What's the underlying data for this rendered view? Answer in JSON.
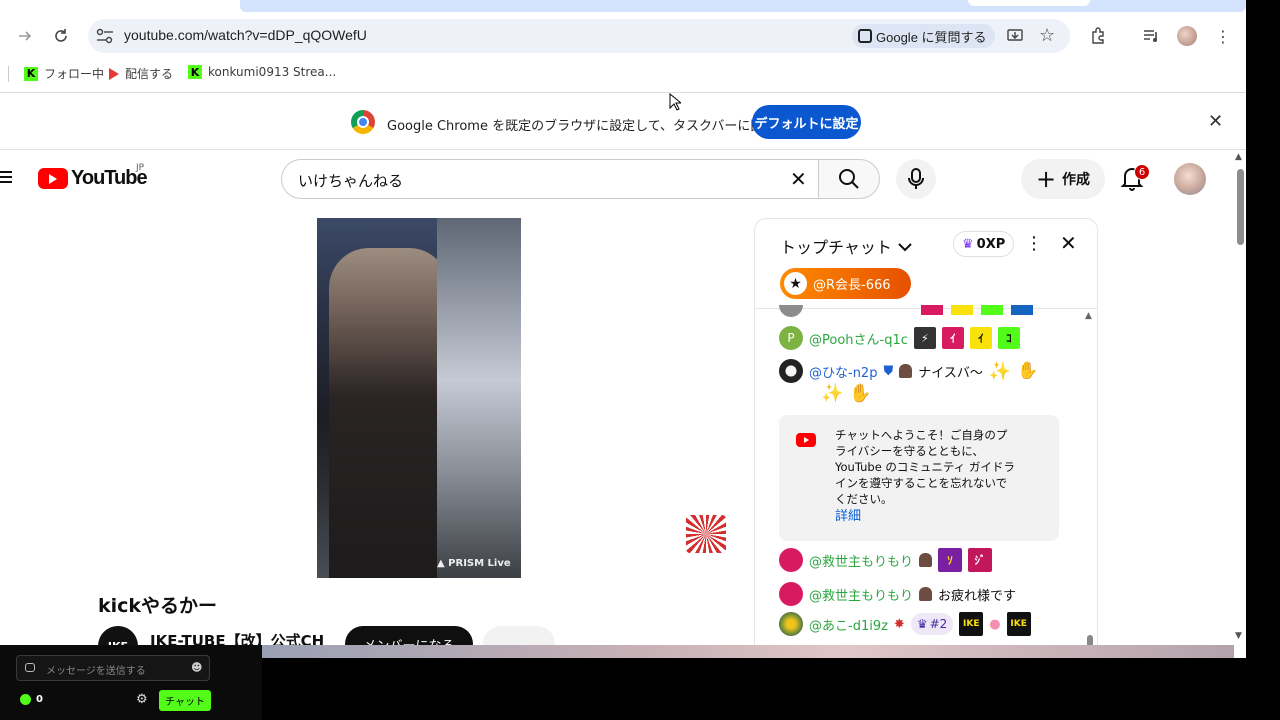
{
  "browser": {
    "url": "youtube.com/watch?v=dDP_qQOWefU",
    "ask_google_label": "Google に質問する",
    "bookmarks": [
      {
        "label": "フォロー中",
        "icon": "kick-logo-icon"
      },
      {
        "label": "配信する",
        "icon": "youtube-red-icon"
      },
      {
        "label": "konkumi0913 Strea...",
        "icon": "kick-logo-icon"
      }
    ]
  },
  "banner": {
    "text": "Google Chrome を既定のブラウザに設定して、タスクバーに固定する",
    "button_label": "デフォルトに設定"
  },
  "youtube": {
    "logo_text": "YouTube",
    "region": "JP",
    "search_value": "いけちゃんねる",
    "create_label": "作成",
    "notification_count": "6",
    "video_watermark": "PRISM Live",
    "video_title": "kickやるかー",
    "channel_name": "IKE-TUBE【改】公式CH",
    "channel_logo_text": "IKE",
    "member_button_label": "メンバーになる"
  },
  "chat": {
    "mode_label": "トップチャット",
    "xp_label": "0XP",
    "pinned_user": "@R会長-666",
    "messages": [
      {
        "author": "@Poohさん-q1c",
        "text": "",
        "avatar_letter": "P",
        "avatar_color": "#7cb342"
      },
      {
        "author": "@ひな-n2p",
        "text": "ナイスバ〜",
        "avatar_letter": "",
        "avatar_color": "#222222"
      },
      {
        "author": "@救世主もりもり",
        "text": "",
        "avatar_letter": "",
        "avatar_color": "#d81b60"
      },
      {
        "author": "@救世主もりもり",
        "text": "お疲れ様です",
        "avatar_letter": "",
        "avatar_color": "#d81b60"
      },
      {
        "author": "@あこ-d1i9z",
        "text": "",
        "avatar_letter": "",
        "avatar_color": "#6d8b3a",
        "badge": "#2"
      }
    ],
    "welcome_text": "チャットへようこそ！ご自身のプライバシーを守るとともに、YouTube のコミュニティ ガイドラインを遵守することを忘れないでください。",
    "welcome_link": "詳細"
  },
  "kick_overlay": {
    "input_placeholder": "メッセージを送信する",
    "points": "0",
    "chat_button_label": "チャット"
  },
  "colors": {
    "youtube_red": "#ff0000",
    "kick_green": "#53fc18",
    "chrome_blue": "#0b57d0"
  }
}
